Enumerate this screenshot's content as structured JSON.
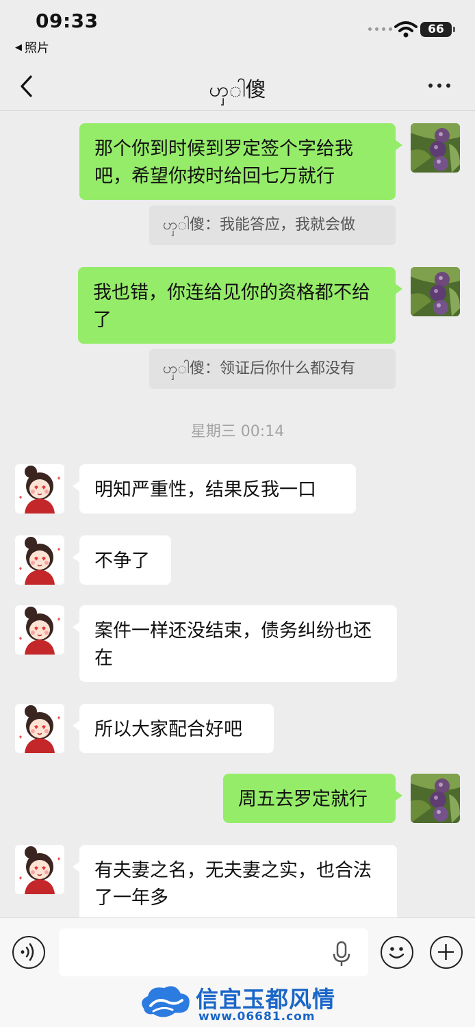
{
  "status_bar": {
    "time": "09:33",
    "back_app": "照片",
    "battery": "66"
  },
  "nav": {
    "title": "ၯ◌ါ傻"
  },
  "messages": [
    {
      "dir": "out",
      "text": "那个你到时候到罗定签个字给我吧，希望你按时给回七万就行"
    },
    {
      "dir": "quote",
      "text": "ၯ◌ါ傻：我能答应，我就会做"
    },
    {
      "dir": "out",
      "text": "我也错，你连给见你的资格都不给了"
    },
    {
      "dir": "quote",
      "text": "ၯ◌ါ傻：领证后你什么都没有"
    },
    {
      "dir": "in",
      "text": "明知严重性，结果反我一口"
    },
    {
      "dir": "in",
      "text": "不争了"
    },
    {
      "dir": "in",
      "text": "案件一样还没结束，债务纠纷也还在"
    },
    {
      "dir": "in",
      "text": "所以大家配合好吧"
    },
    {
      "dir": "out",
      "text": "周五去罗定就行"
    },
    {
      "dir": "in",
      "text": "有夫妻之名，无夫妻之实，也合法了一年多"
    }
  ],
  "timestamp": "星期三 00:14",
  "watermark": {
    "title": "信宜玉都风情",
    "url": "www.06681.com"
  },
  "colors": {
    "outgoing_bubble": "#95ec69",
    "incoming_bubble": "#ffffff",
    "background": "#ededed"
  },
  "icons": [
    "back-icon",
    "more-icon",
    "voice-icon",
    "mic-icon",
    "emoji-icon",
    "plus-icon"
  ]
}
